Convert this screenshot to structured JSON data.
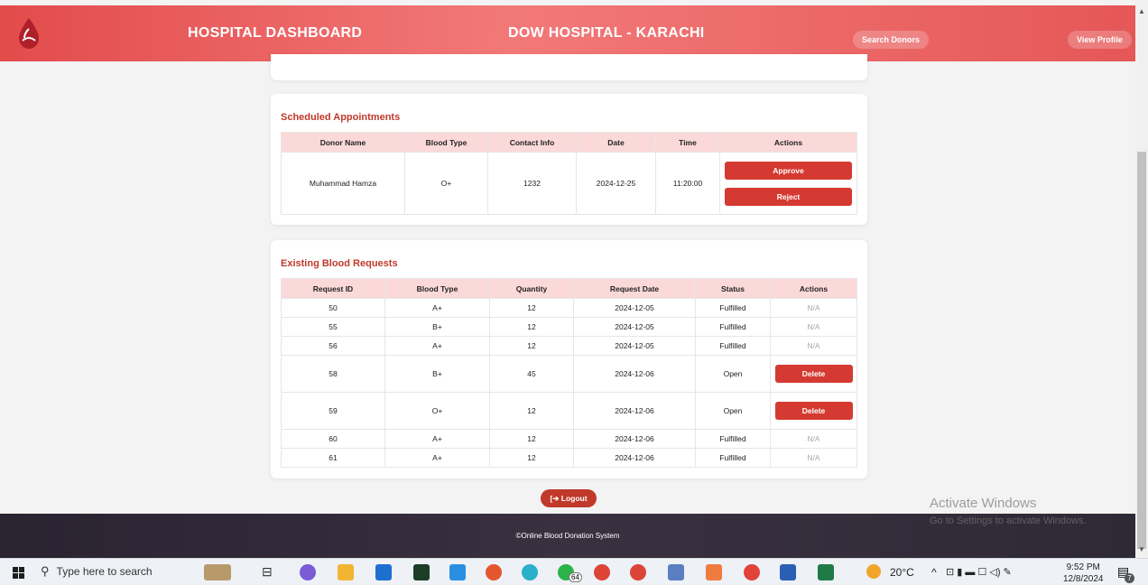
{
  "header": {
    "title": "HOSPITAL DASHBOARD",
    "hospital_name": "DOW HOSPITAL - KARACHI",
    "search_label": "Search Donors",
    "profile_label": "View Profile"
  },
  "appointments": {
    "title": "Scheduled Appointments",
    "columns": [
      "Donor Name",
      "Blood Type",
      "Contact Info",
      "Date",
      "Time",
      "Actions"
    ],
    "rows": [
      {
        "donor": "Muhammad Hamza",
        "blood": "O+",
        "contact": "1232",
        "date": "2024-12-25",
        "time": "11:20:00",
        "approve": "Approve",
        "reject": "Reject"
      }
    ]
  },
  "requests": {
    "title": "Existing Blood Requests",
    "columns": [
      "Request ID",
      "Blood Type",
      "Quantity",
      "Request Date",
      "Status",
      "Actions"
    ],
    "rows": [
      {
        "id": "50",
        "blood": "A+",
        "qty": "12",
        "date": "2024-12-05",
        "status": "Fulfilled",
        "action": "N/A"
      },
      {
        "id": "55",
        "blood": "B+",
        "qty": "12",
        "date": "2024-12-05",
        "status": "Fulfilled",
        "action": "N/A"
      },
      {
        "id": "56",
        "blood": "A+",
        "qty": "12",
        "date": "2024-12-05",
        "status": "Fulfilled",
        "action": "N/A"
      },
      {
        "id": "58",
        "blood": "B+",
        "qty": "45",
        "date": "2024-12-06",
        "status": "Open",
        "action": "Delete"
      },
      {
        "id": "59",
        "blood": "O+",
        "qty": "12",
        "date": "2024-12-06",
        "status": "Open",
        "action": "Delete"
      },
      {
        "id": "60",
        "blood": "A+",
        "qty": "12",
        "date": "2024-12-06",
        "status": "Fulfilled",
        "action": "N/A"
      },
      {
        "id": "61",
        "blood": "A+",
        "qty": "12",
        "date": "2024-12-06",
        "status": "Fulfilled",
        "action": "N/A"
      }
    ]
  },
  "logout_label": "Logout",
  "footer_text": "©Online Blood Donation System",
  "watermark": {
    "line1": "Activate Windows",
    "line2": "Go to Settings to activate Windows."
  },
  "taskbar": {
    "search_placeholder": "Type here to search",
    "weather": "20°C",
    "badge": "64",
    "time": "9:52 PM",
    "date": "12/8/2024",
    "notification_count": "7"
  },
  "colors": {
    "header_red": "#e34b4b",
    "accent": "#c0392b",
    "button_red": "#d53a32",
    "table_header": "#fcd9d9",
    "footer_dark": "#2a2330"
  }
}
